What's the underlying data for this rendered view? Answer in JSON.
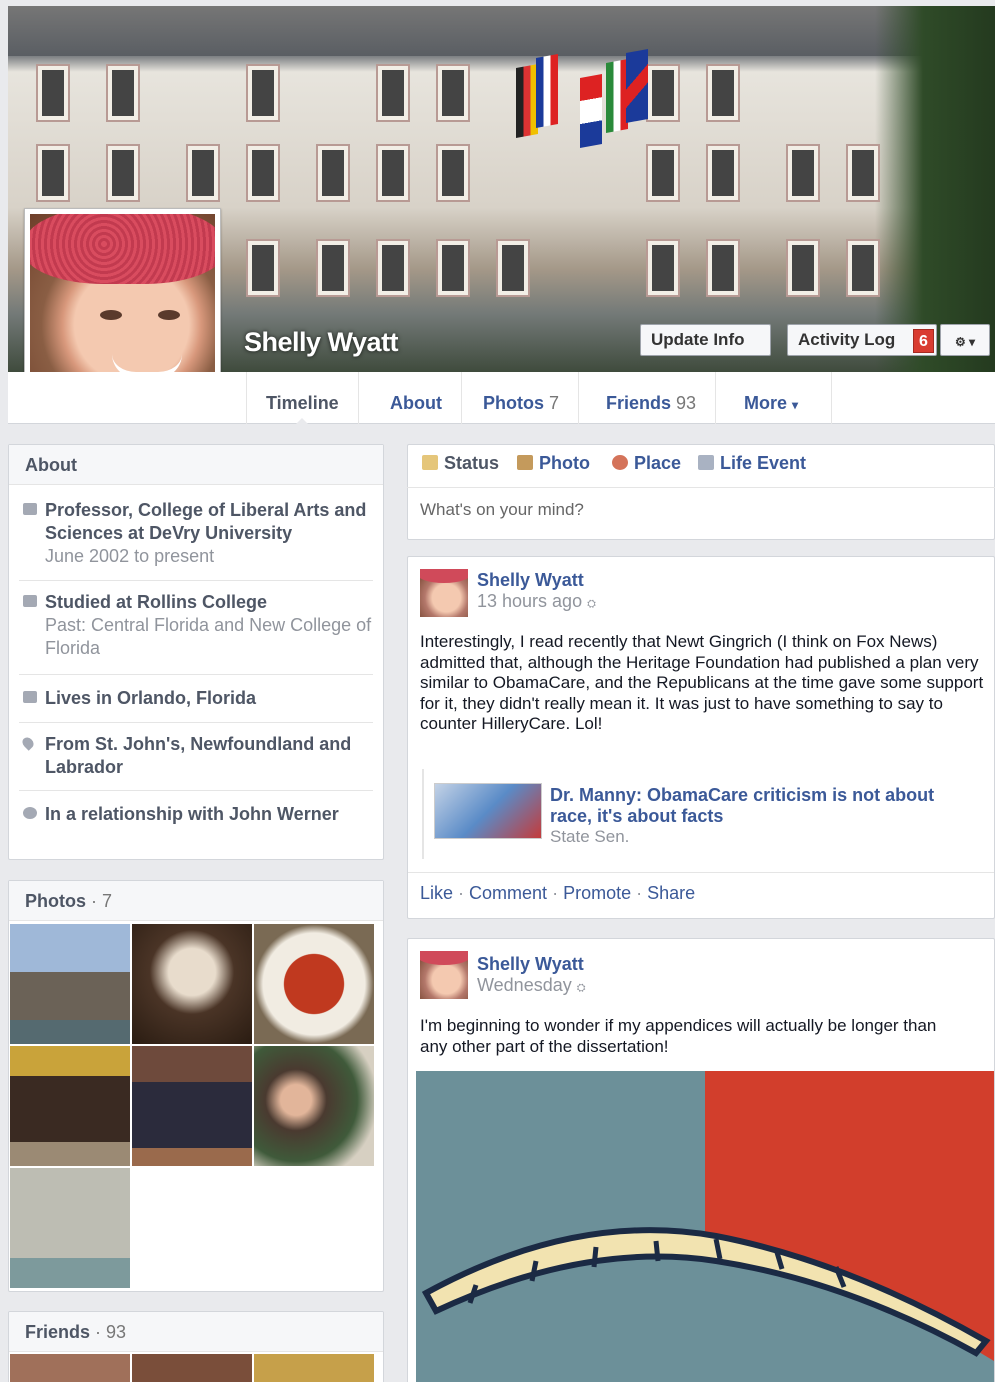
{
  "profile": {
    "name": "Shelly Wyatt",
    "buttons": {
      "update_info": "Update Info",
      "activity_log": "Activity Log",
      "activity_count": "6"
    }
  },
  "tabs": [
    {
      "label": "Timeline",
      "count": ""
    },
    {
      "label": "About",
      "count": ""
    },
    {
      "label": "Photos",
      "count": "7"
    },
    {
      "label": "Friends",
      "count": "93"
    },
    {
      "label": "More",
      "count": ""
    }
  ],
  "about": {
    "title": "About",
    "items": [
      {
        "text": "Professor, College of Liberal Arts and Sciences at DeVry University",
        "sub": "June 2002 to present"
      },
      {
        "text": "Studied at Rollins College",
        "sub": "Past: Central Florida and New College of Florida"
      },
      {
        "text": "Lives in Orlando, Florida",
        "sub": ""
      },
      {
        "text": "From St. John's, Newfoundland and Labrador",
        "sub": ""
      },
      {
        "text": "In a relationship with John Werner",
        "sub": ""
      }
    ]
  },
  "photos": {
    "title": "Photos",
    "sep": " · ",
    "count": "7"
  },
  "friends": {
    "title": "Friends",
    "sep": " · ",
    "count": "93"
  },
  "composer": {
    "tabs": [
      "Status",
      "Photo",
      "Place",
      "Life Event"
    ],
    "placeholder": "What's on your mind?"
  },
  "posts": [
    {
      "author": "Shelly Wyatt",
      "time": "13 hours ago",
      "text": "Interestingly, I read recently that Newt Gingrich (I think on Fox News) admitted that, although the Heritage Foundation had published a plan very similar to ObamaCare, and the Republicans at the time gave some support for it, they didn't really mean it. It was just to have something to say to counter HilleryCare. Lol!",
      "share": {
        "title": "Dr. Manny: ObamaCare criticism is not about race, it's about facts",
        "source": "State Sen."
      },
      "actions": [
        "Like",
        "Comment",
        "Promote",
        "Share"
      ]
    },
    {
      "author": "Shelly Wyatt",
      "time": "Wednesday",
      "text": "I'm beginning to wonder if my appendices will actually be longer than any other part of the dissertation!"
    }
  ]
}
